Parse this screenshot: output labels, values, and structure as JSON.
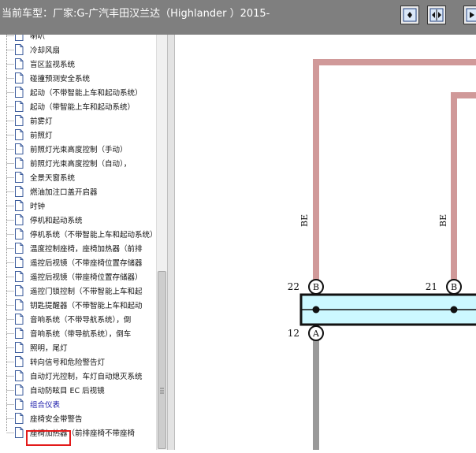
{
  "window": {
    "title": "当前车型：厂家:G-广汽丰田汉兰达（Highlander ）2015-"
  },
  "toolbar": {
    "buttons": [
      {
        "name": "fit-page-button",
        "icon": "fit-page-icon"
      },
      {
        "name": "fit-width-button",
        "icon": "fit-width-icon"
      },
      {
        "name": "next-button",
        "icon": "next-icon"
      }
    ]
  },
  "sidebar": {
    "items": [
      {
        "label": "喇叭"
      },
      {
        "label": "冷却风扇"
      },
      {
        "label": "盲区监视系统"
      },
      {
        "label": "碰撞预测安全系统"
      },
      {
        "label": "起动（不带智能上车和起动系统）"
      },
      {
        "label": "起动（带智能上车和起动系统）"
      },
      {
        "label": "前雾灯"
      },
      {
        "label": "前照灯"
      },
      {
        "label": "前照灯光束高度控制（手动）"
      },
      {
        "label": "前照灯光束高度控制（自动），"
      },
      {
        "label": "全景天窗系统"
      },
      {
        "label": "燃油加注口盖开启器"
      },
      {
        "label": "时钟"
      },
      {
        "label": "停机和起动系统"
      },
      {
        "label": "停机系统（不带智能上车和起动系统）"
      },
      {
        "label": "温度控制座椅，座椅加热器（前排"
      },
      {
        "label": "遥控后视镜（不带座椅位置存储器"
      },
      {
        "label": "遥控后视镜（带座椅位置存储器）"
      },
      {
        "label": "遥控门锁控制（不带智能上车和起"
      },
      {
        "label": "钥匙提醒器（不带智能上车和起动"
      },
      {
        "label": "音响系统（不带导航系统），倒"
      },
      {
        "label": "音响系统（带导航系统），倒车"
      },
      {
        "label": "照明，尾灯"
      },
      {
        "label": "转向信号和危险警告灯"
      },
      {
        "label": "自动灯光控制，车灯自动熄灭系统"
      },
      {
        "label": "自动防眩目 EC 后视镜"
      },
      {
        "label": "组合仪表",
        "selected": true
      },
      {
        "label": "座椅安全带警告"
      },
      {
        "label": "座椅加热器（前排座椅不带座椅"
      }
    ],
    "selected_color": "#e31a1a"
  },
  "diagram": {
    "wire_color_name": "BE",
    "wire_color": "#d09999",
    "ground_wire_color": "#999999",
    "connector_fill": "#ccf8ff",
    "pins": [
      {
        "number": "22",
        "letter": "B"
      },
      {
        "number": "21",
        "letter": "B"
      },
      {
        "number": "12",
        "letter": "A"
      }
    ]
  }
}
